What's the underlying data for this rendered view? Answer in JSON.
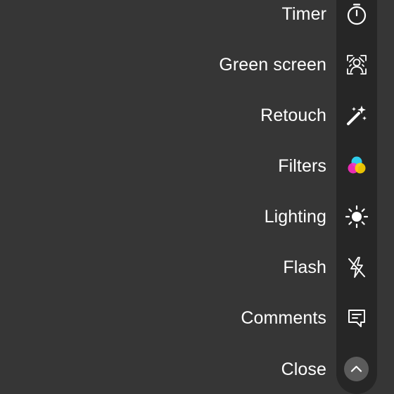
{
  "menu": {
    "items": [
      {
        "label": "Timer",
        "icon": "timer-icon"
      },
      {
        "label": "Green screen",
        "icon": "green-screen-icon"
      },
      {
        "label": "Retouch",
        "icon": "magic-wand-icon"
      },
      {
        "label": "Filters",
        "icon": "filters-icon"
      },
      {
        "label": "Lighting",
        "icon": "sun-icon"
      },
      {
        "label": "Flash",
        "icon": "flash-off-icon"
      },
      {
        "label": "Comments",
        "icon": "comment-icon"
      },
      {
        "label": "Close",
        "icon": "chevron-up-icon"
      }
    ]
  },
  "colors": {
    "background": "#363636",
    "rail": "#262626",
    "text": "#ffffff",
    "filter_cyan": "#2fd6f5",
    "filter_magenta": "#ff2ec3",
    "filter_yellow": "#ffd400"
  }
}
